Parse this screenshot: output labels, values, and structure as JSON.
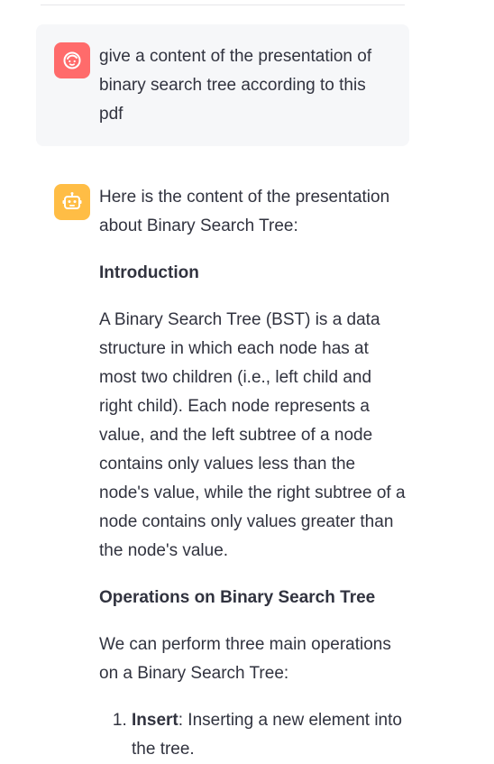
{
  "divider": true,
  "messages": {
    "user": {
      "avatar_icon": "user-face-icon",
      "avatar_color": "#ff6b6b",
      "text": "give a content of the presentation of binary search tree according to this pdf"
    },
    "assistant": {
      "avatar_icon": "robot-icon",
      "avatar_color": "#ffbd45",
      "intro": "Here is the content of the presentation about Binary Search Tree:",
      "section1_heading": "Introduction",
      "section1_body": "A Binary Search Tree (BST) is a data structure in which each node has at most two children (i.e., left child and right child). Each node represents a value, and the left subtree of a node contains only values less than the node's value, while the right subtree of a node contains only values greater than the node's value.",
      "section2_heading": "Operations on Binary Search Tree",
      "section2_body": "We can perform three main operations on a Binary Search Tree:",
      "operations": [
        {
          "title": "Insert",
          "desc": ": Inserting a new element into the tree."
        }
      ]
    }
  }
}
